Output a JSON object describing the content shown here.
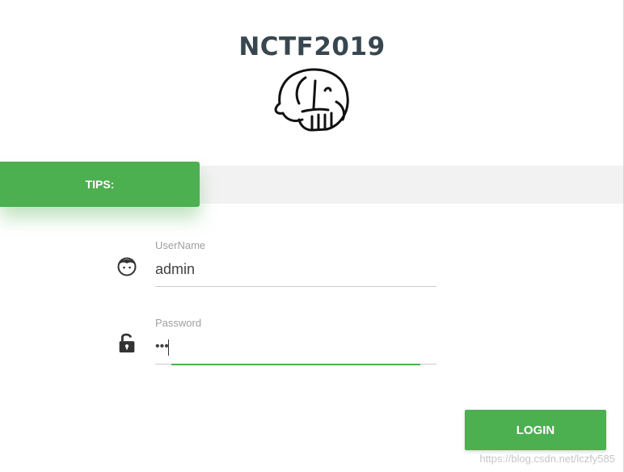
{
  "page": {
    "title": "NCTF2019"
  },
  "tips": {
    "label": "TIPS:",
    "message": ""
  },
  "form": {
    "username": {
      "label": "UserName",
      "value": "admin",
      "icon": "user-face-icon"
    },
    "password": {
      "label": "Password",
      "value": "•••",
      "icon": "unlock-icon"
    },
    "login_label": "LOGIN"
  },
  "watermark": "https://blog.csdn.net/lczfy585",
  "colors": {
    "accent": "#4caf50",
    "title": "#37474f",
    "strip": "#f2f2f2"
  }
}
